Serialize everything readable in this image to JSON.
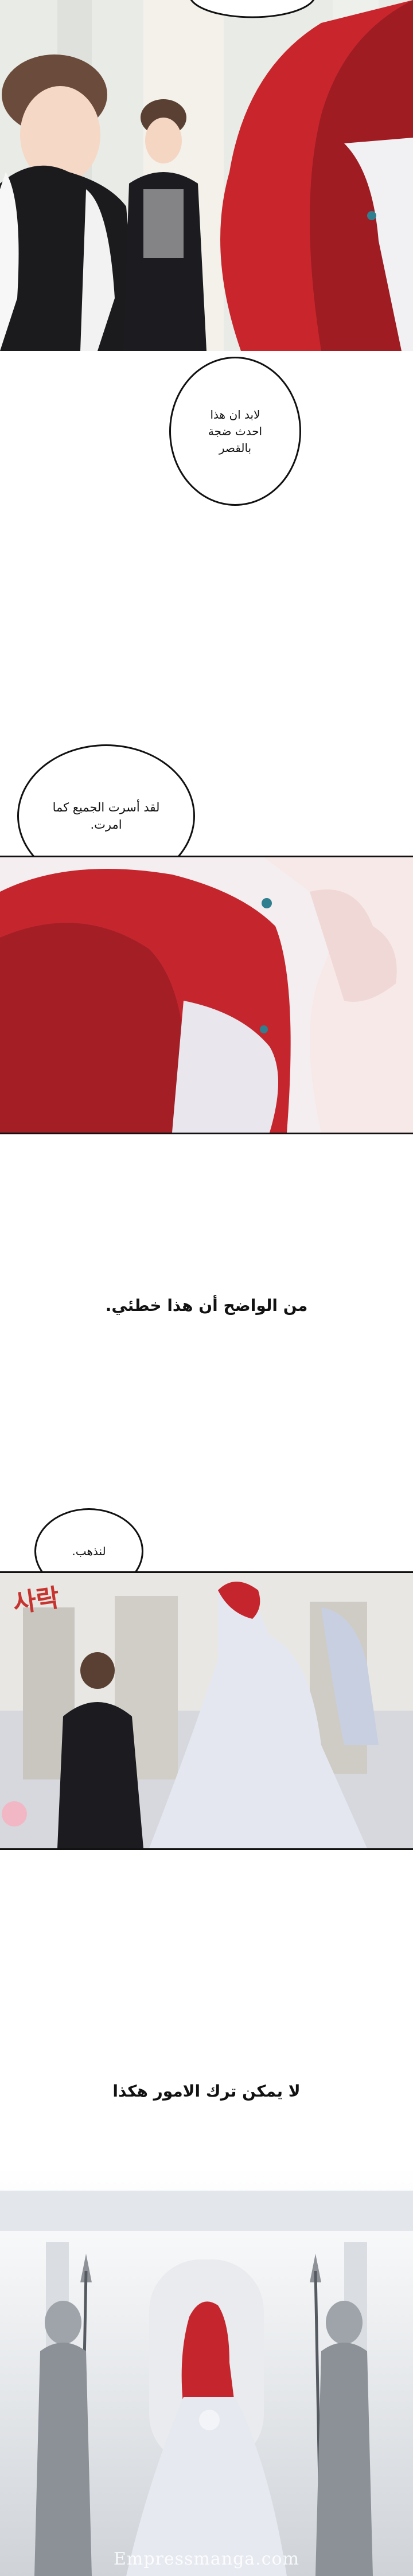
{
  "speech": {
    "bubble_1": [
      "لابد ان هذا",
      "احدث ضجة",
      "بالقصر"
    ],
    "bubble_2": [
      "لقد أسرت الجميع كما",
      "امرت."
    ],
    "bubble_3": "لنذهب."
  },
  "captions": {
    "caption_1": "من الواضح أن هذا خطئي.",
    "caption_2": "لا يمكن ترك الامور هكذا"
  },
  "sfx": "사락",
  "watermark": "Empressmanga.com"
}
